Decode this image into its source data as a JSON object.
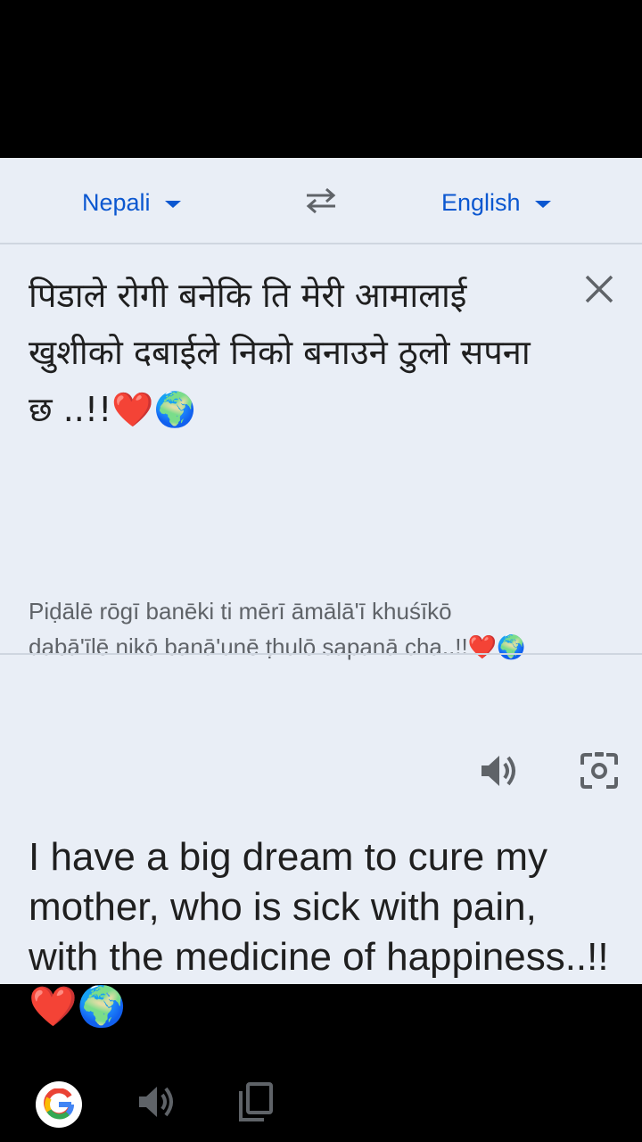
{
  "languages": {
    "source": "Nepali",
    "target": "English"
  },
  "source": {
    "text": "पिडाले रोगी बनेकि ति मेरी आमालाई खुशीको दबाईले निको बनाउने ठुलो सपना छ ..!!❤️🌍",
    "transliteration": "Piḍālē rōgī banēki ti mērī āmālā'ī khuśīkō dabā'īlē nikō banā'unē ṭhulō sapanā cha..!!❤️🌍"
  },
  "translation": {
    "text": "I have a big dream to cure my mother, who is sick with pain, with the medicine of happiness..!!❤️🌍"
  },
  "icons": {
    "swap": "swap-languages-icon",
    "close": "close-icon",
    "source_speaker": "speaker-icon",
    "camera": "camera-icon",
    "google": "google-logo-icon",
    "target_speaker": "speaker-icon",
    "copy": "copy-icon"
  },
  "colors": {
    "accent": "#0b57d0",
    "panel_background": "#e9eef6",
    "icon_gray": "#5f6368",
    "text": "#1f1f1f"
  }
}
